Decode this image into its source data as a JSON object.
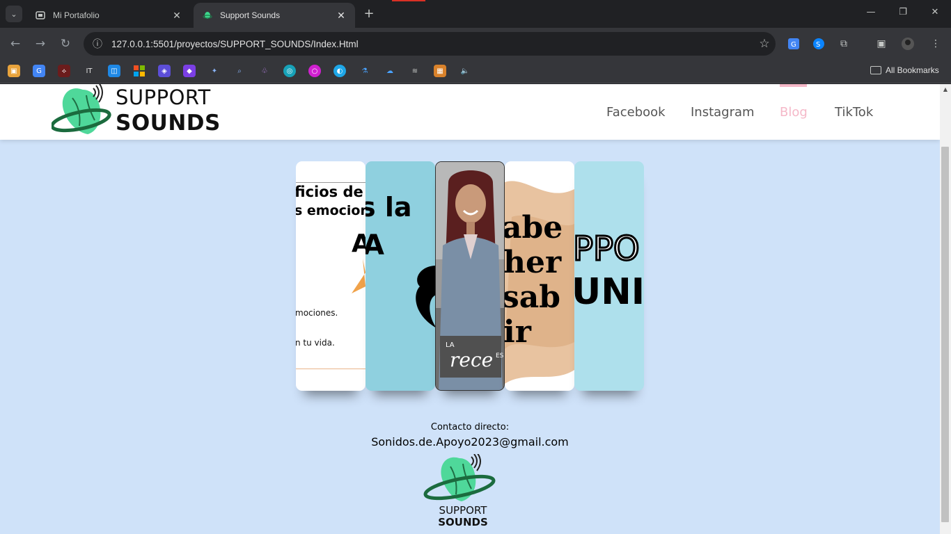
{
  "browser": {
    "tabs": [
      {
        "title": "Mi Portafolio",
        "active": false
      },
      {
        "title": "Support Sounds",
        "active": true
      }
    ],
    "url": "127.0.0.1:5501/proyectos/SUPPORT_SOUNDS/Index.Html",
    "bookmarks_label": "All Bookmarks"
  },
  "site": {
    "logo_line1": "SUPPORT",
    "logo_line2": "SOUNDS",
    "nav": [
      {
        "label": "Facebook",
        "active": false
      },
      {
        "label": "Instagram",
        "active": false
      },
      {
        "label": "Blog",
        "active": true
      },
      {
        "label": "TikTok",
        "active": false
      }
    ],
    "cards": {
      "card1": {
        "line1": "ficios de li",
        "line2": "s emocione",
        "big": "A",
        "small1": "mociones.",
        "small2": "n tu vida."
      },
      "card2": {
        "line1": "s la",
        "big": "A"
      },
      "card3": {
        "caption": "rece",
        "caption_suffix": "ES",
        "caption_prefix": "LA"
      },
      "card4": {
        "l1": "abe",
        "l2": "her",
        "l3": "sab",
        "l4": "ir"
      },
      "card5": {
        "l1": "PPO",
        "l2": "UNI"
      }
    },
    "footer": {
      "contact_label": "Contacto directo:",
      "email": "Sonidos.de.Apoyo2023@gmail.com",
      "logo_line1": "SUPPORT",
      "logo_line2": "SOUNDS"
    },
    "colors": {
      "page_bg": "#cfe2f9",
      "nav_active": "#f5b8c8",
      "logo_green": "#3dd68c"
    }
  }
}
